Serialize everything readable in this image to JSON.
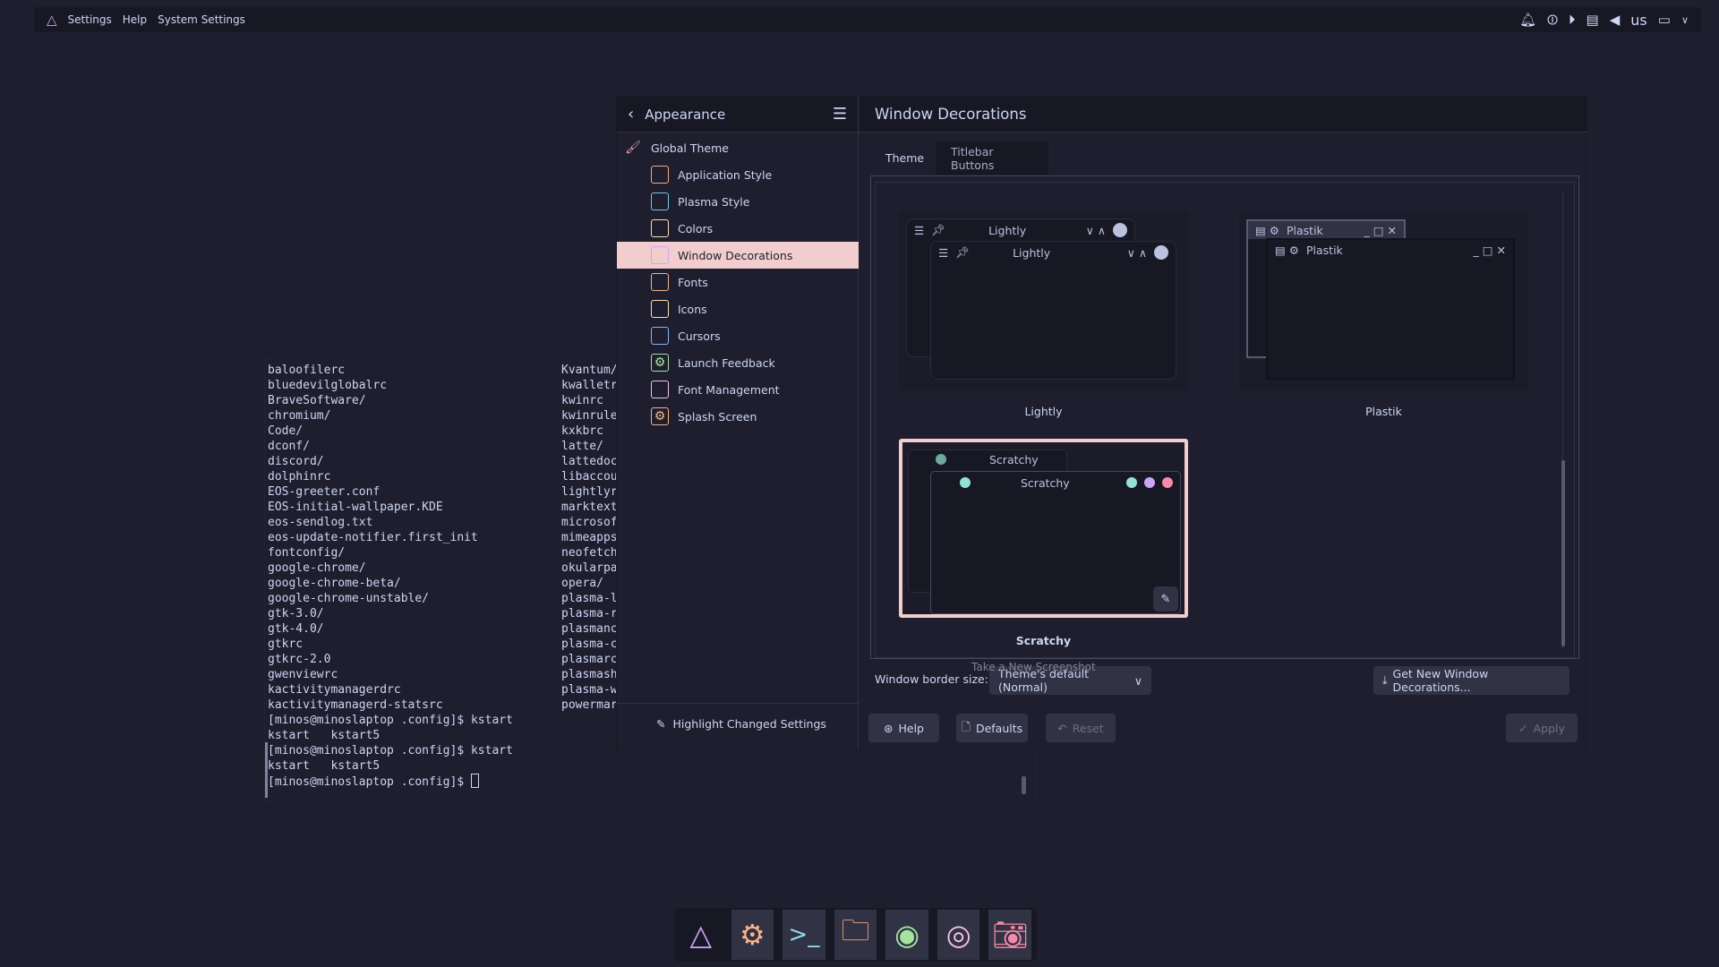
{
  "topbar": {
    "menu": [
      "Settings",
      "Help",
      "System Settings"
    ],
    "keyboard_layout": "us",
    "tray_icons": [
      "notifications-icon",
      "power-icon",
      "media-play-icon",
      "clipboard-icon",
      "volume-icon",
      "display-icon",
      "chevron-down-icon"
    ]
  },
  "terminal": {
    "col1": [
      "baloofilerc",
      "bluedevilglobalrc",
      "BraveSoftware/",
      "chromium/",
      "Code/",
      "dconf/",
      "discord/",
      "dolphinrc",
      "EOS-greeter.conf",
      "EOS-initial-wallpaper.KDE",
      "eos-sendlog.txt",
      "eos-update-notifier.first_init",
      "fontconfig/",
      "google-chrome/",
      "google-chrome-beta/",
      "google-chrome-unstable/",
      "gtk-3.0/",
      "gtk-4.0/",
      "gtkrc",
      "gtkrc-2.0",
      "gwenviewrc",
      "kactivitymanagerdrc",
      "kactivitymanagerd-statsrc",
      "[minos@minoslaptop .config]$ kstart",
      "kstart   kstart5",
      "[minos@minoslaptop .config]$ kstart",
      "kstart   kstart5",
      "[minos@minoslaptop .config]$ "
    ],
    "col2": [
      "Kvantum/",
      "kwalletr",
      "kwinrc",
      "kwinrule",
      "kxkbrc",
      "latte/",
      "lattedoc",
      "libaccou",
      "lightlyr",
      "marktext",
      "microsof",
      "mimeapps",
      "neofetch",
      "okularpa",
      "opera/",
      "plasma-l",
      "plasma-r",
      "plasmanc",
      "plasma-c",
      "plasmarc",
      "plasmash",
      "plasma-w",
      "powermar"
    ]
  },
  "sidebar": {
    "back_title": "Appearance",
    "global": {
      "label": "Global Theme",
      "icon": "paint-roller-icon"
    },
    "items": [
      {
        "label": "Application Style",
        "icon": "application-style-icon",
        "color": "#f5a97f"
      },
      {
        "label": "Plasma Style",
        "icon": "plasma-style-icon",
        "color": "#74c7ec"
      },
      {
        "label": "Colors",
        "icon": "colors-icon",
        "color": "#f9e2af"
      },
      {
        "label": "Window Decorations",
        "icon": "window-decorations-icon",
        "color": "#cba6f7"
      },
      {
        "label": "Fonts",
        "icon": "fonts-icon",
        "color": "#fab387"
      },
      {
        "label": "Icons",
        "icon": "icons-icon",
        "color": "#f9e2af"
      },
      {
        "label": "Cursors",
        "icon": "cursors-icon",
        "color": "#89b4fa"
      },
      {
        "label": "Launch Feedback",
        "icon": "gear-icon",
        "color": "#a6e3a1"
      },
      {
        "label": "Font Management",
        "icon": "font-management-icon",
        "color": "#f5c2e7"
      },
      {
        "label": "Splash Screen",
        "icon": "gear-icon",
        "color": "#fab387"
      }
    ],
    "selected": "Window Decorations",
    "highlight_changed": "Highlight Changed Settings"
  },
  "main": {
    "title": "Window Decorations",
    "tabs": [
      "Theme",
      "Titlebar Buttons"
    ],
    "active_tab": "Theme",
    "themes": [
      {
        "name": "Lightly",
        "title": "Lightly"
      },
      {
        "name": "Plastik",
        "title": "Plastik"
      },
      {
        "name": "Scratchy",
        "title": "Scratchy",
        "selected": true
      }
    ],
    "tooltip_ghost": "Take a New Screenshot",
    "border_label": "Window border size:",
    "border_value": "Theme's default (Normal)",
    "get_new": "Get New Window Decorations...",
    "buttons": {
      "help": "Help",
      "defaults": "Defaults",
      "reset": "Reset",
      "apply": "Apply"
    }
  },
  "colors": {
    "accent": "#f2cdcd",
    "background": "#1e1e2e",
    "panel": "#181825",
    "text": "#cdd6f4"
  },
  "dock": [
    "app-launcher-icon",
    "system-settings-icon",
    "terminal-icon",
    "file-manager-icon",
    "spotify-icon",
    "browser-icon",
    "screenshot-icon"
  ]
}
